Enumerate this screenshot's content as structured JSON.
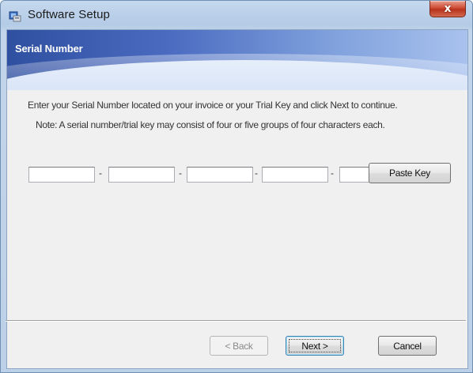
{
  "window": {
    "title": "Software Setup",
    "close_label": "x",
    "app_icon": "setup-installer-icon"
  },
  "banner": {
    "heading": "Serial Number"
  },
  "instructions": {
    "line1": "Enter your Serial Number located on your invoice or your Trial Key and click Next to continue.",
    "line2": "Note: A serial number/trial key may consist of four or five groups of four characters each."
  },
  "serial": {
    "groups": [
      "",
      "",
      "",
      "",
      ""
    ],
    "separator": "-"
  },
  "buttons": {
    "paste_key": "Paste Key",
    "back": "< Back",
    "next": "Next >",
    "cancel": "Cancel"
  },
  "colors": {
    "banner_dark": "#2f4fa0",
    "banner_light": "#a9c2ee",
    "close_red": "#cf4d35"
  }
}
